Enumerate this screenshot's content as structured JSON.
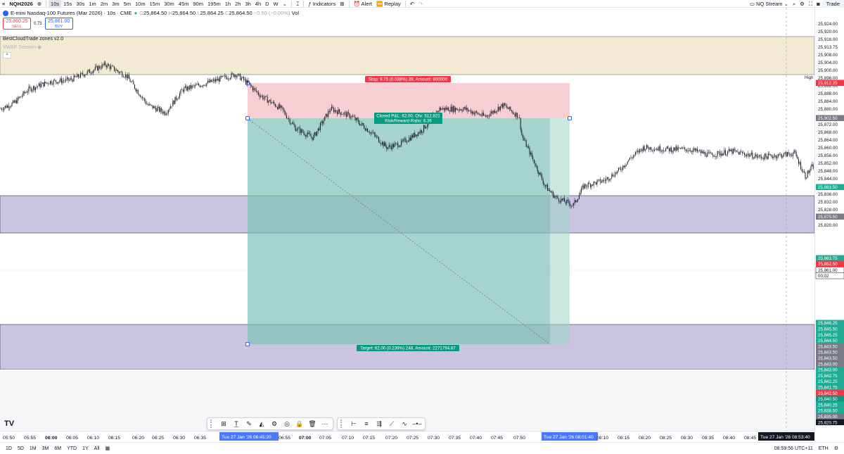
{
  "toolbar": {
    "symbol": "NQH2026",
    "add_icon": "plus-circle-icon",
    "timeframes": [
      "10s",
      "15s",
      "30s",
      "1m",
      "2m",
      "3m",
      "5m",
      "10m",
      "15m",
      "30m",
      "45m",
      "90m",
      "195m",
      "1h",
      "2h",
      "3h",
      "4h",
      "D",
      "W"
    ],
    "active_timeframe": "10s",
    "indicators_label": "Indicators",
    "alert_label": "Alert",
    "replay_label": "Replay",
    "layout_label": "NQ Stream",
    "trade_label": "Trade"
  },
  "legend": {
    "title": "E-mini Nasdaq-100 Futures (Mar 2026) · 10s · CME",
    "o_label": "O",
    "o": "25,864.50",
    "h_label": "H",
    "h": "25,864.50",
    "l_label": "L",
    "l": "25,864.25",
    "c_label": "C",
    "c": "25,864.50",
    "change": "−0.50 (−0.00%)",
    "vol_label": "Vol",
    "sell_price": "25,860.25",
    "sell_label": "SELL",
    "spread": "0.75",
    "buy_price": "25,861.00",
    "buy_label": "BUY",
    "indicator1": "BestCloudTrade zones v2.0",
    "indicator2": "VWAP Session",
    "collapse": "^"
  },
  "position": {
    "stop_label": "Stop: 9.75 (0.038%) 39, Amount: 800000",
    "pnl_label": "Closed P&L: 62.00, Qty: 512.821",
    "rr_label": "Risk/Reward Ratio: 6.36",
    "target_label": "Target: 62.00 (0.239%) 248, Amount: 2271794.87"
  },
  "price_axis": {
    "ticks": [
      "25,924.00",
      "25,920.00",
      "25,916.00",
      "25,913.75",
      "25,908.00",
      "25,904.00",
      "25,900.00",
      "25,896.00",
      "25,892.00",
      "25,888.00",
      "25,884.00",
      "25,880.00",
      "25,876.00",
      "25,872.00",
      "25,868.00",
      "25,864.00",
      "25,860.00",
      "25,856.00",
      "25,852.00",
      "25,848.00",
      "25,844.00",
      "25,840.00",
      "25,836.00",
      "25,832.00",
      "25,828.00",
      "25,824.00",
      "25,820.00"
    ],
    "high_label": "High",
    "tags": [
      {
        "text": "25,912.25",
        "color": "#f23645"
      },
      {
        "text": "25,902.50",
        "color": "#787b86"
      },
      {
        "text": "25,883.50",
        "color": "#22ab94"
      },
      {
        "text": "25,875.50",
        "color": "#787b86"
      },
      {
        "text": "25,863.75",
        "color": "#22ab94"
      },
      {
        "text": "25,862.50",
        "color": "#f23645"
      },
      {
        "text": "25,861.00",
        "color": "#131722"
      },
      {
        "text": "00:02",
        "color": "#131722"
      },
      {
        "text": "25,846.25",
        "color": "#22ab94"
      },
      {
        "text": "25,845.50",
        "color": "#22ab94"
      },
      {
        "text": "25,845.25",
        "color": "#22ab94"
      },
      {
        "text": "25,844.50",
        "color": "#22ab94"
      },
      {
        "text": "25,843.50",
        "color": "#787b86"
      },
      {
        "text": "25,843.50",
        "color": "#787b86"
      },
      {
        "text": "25,843.50",
        "color": "#787b86"
      },
      {
        "text": "25,843.00",
        "color": "#787b86"
      },
      {
        "text": "25,843.00",
        "color": "#22ab94"
      },
      {
        "text": "25,842.75",
        "color": "#22ab94"
      },
      {
        "text": "25,842.25",
        "color": "#22ab94"
      },
      {
        "text": "25,841.75",
        "color": "#22ab94"
      },
      {
        "text": "25,842.50",
        "color": "#f23645"
      },
      {
        "text": "25,840.50",
        "color": "#089981"
      },
      {
        "text": "25,840.25",
        "color": "#22ab94"
      },
      {
        "text": "25,838.50",
        "color": "#22ab94"
      },
      {
        "text": "25,835.00",
        "color": "#787b86"
      },
      {
        "text": "25,820.75",
        "color": "#131722"
      },
      {
        "text": "25,834.75",
        "color": "#f23645"
      },
      {
        "text": "25,834.75",
        "color": "#f23645"
      }
    ]
  },
  "time_axis": {
    "ticks": [
      "05:50",
      "05:55",
      "06:00",
      "06:05",
      "06:10",
      "06:15",
      "06:20",
      "06:25",
      "06:30",
      "06:35",
      "06:55",
      "07:00",
      "07:05",
      "07:10",
      "07:15",
      "07:20",
      "07:25",
      "07:30",
      "07:35",
      "07:40",
      "07:45",
      "07:50",
      "08:10",
      "08:15",
      "08:20",
      "08:25",
      "08:30",
      "08:35",
      "08:40",
      "08:45"
    ],
    "marker1": "Tue 27 Jan '26   06:45:20",
    "marker2": "Tue 27 Jan '26   08:01:40",
    "marker3": "Tue 27 Jan '26   08:53:40"
  },
  "bottom": {
    "ranges": [
      "1D",
      "5D",
      "1M",
      "3M",
      "6M",
      "YTD",
      "1Y",
      "All"
    ],
    "clock": "08:59:56 UTC+11",
    "session": "ETH"
  },
  "logo": "TV",
  "colors": {
    "zone_top": "#f3ead3",
    "zone_purple": "#b8b0d8",
    "stop_fill": "#f5c6cc",
    "target_fill": "#9fd3c7",
    "candles": "#131722"
  }
}
